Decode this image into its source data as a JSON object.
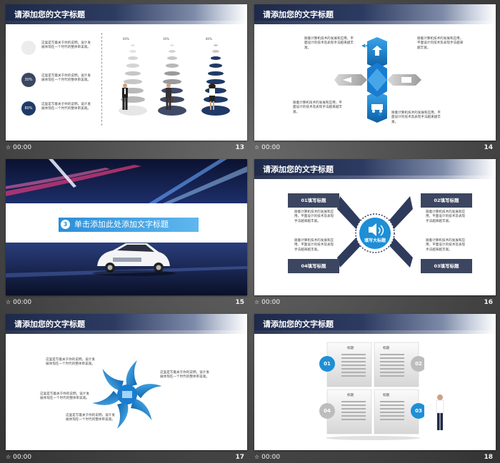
{
  "slides": [
    {
      "number": "13",
      "time": "00:00",
      "title": "请添加您的文字标题",
      "items": [
        {
          "badge": "",
          "text": "这里是写着关于你的说明，设计发展体现在一个时代的整体审美观。"
        },
        {
          "badge": "30%",
          "text": "这里是写着关于你的说明，设计发展体现在一个时代的整体审美观。"
        },
        {
          "badge": "80%",
          "text": "这里是写着关于你的说明，设计发展体现在一个时代的整体审美观。"
        }
      ],
      "columns": [
        {
          "label": "60%"
        },
        {
          "label": "30%"
        },
        {
          "label": "80%"
        }
      ]
    },
    {
      "number": "14",
      "time": "00:00",
      "title": "请添加您的文字标题",
      "texts": [
        "随着计算机技术的发展和应用，平面设计的技术及表现手法越来越丰富。",
        "随着计算机技术的发展和应用，平面设计的技术及表现手法越来越丰富。",
        "随着计算机技术的发展和应用，平面设计的技术及表现手法越来越丰富。",
        "随着计算机技术的发展和应用，平面设计的技术及表现手法越来越丰富。"
      ]
    },
    {
      "number": "15",
      "time": "00:00",
      "banner_num": "3",
      "banner_text": "单击添加此处添加文字标题"
    },
    {
      "number": "16",
      "time": "00:00",
      "title": "请添加您的文字标题",
      "center": "填写大标题",
      "tags": [
        "01填写标题",
        "02填写标题",
        "04填写标题",
        "03填写标题"
      ],
      "texts": [
        "随着计算机技术的发展和应用，平面设计的技术及表现手法越来越丰富。",
        "随着计算机技术的发展和应用，平面设计的技术及表现手法越来越丰富。",
        "随着计算机技术的发展和应用，平面设计的技术及表现手法越来越丰富。",
        "随着计算机技术的发展和应用，平面设计的技术及表现手法越来越丰富。"
      ]
    },
    {
      "number": "17",
      "time": "00:00",
      "title": "请添加您的文字标题",
      "texts": [
        "这里是写着关于你的说明，设计发展体现在一个时代的整体审美观。",
        "这里是写着关于你的说明，设计发展体现在一个时代的整体审美观。",
        "这里是写着关于你的说明，设计发展体现在一个时代的整体审美观。",
        "这里是写着关于你的说明，设计发展体现在一个时代的整体审美观。"
      ]
    },
    {
      "number": "18",
      "time": "00:00",
      "title": "请添加您的文字标题",
      "quads": [
        {
          "num": "01",
          "label": "标题"
        },
        {
          "num": "02",
          "label": "标题"
        },
        {
          "num": "04",
          "label": "标题"
        },
        {
          "num": "03",
          "label": "标题"
        }
      ]
    }
  ],
  "colors": {
    "navy": "#2f3b5c",
    "accent_blue": "#1e8fd6",
    "gray_tag": "#3c4660"
  }
}
